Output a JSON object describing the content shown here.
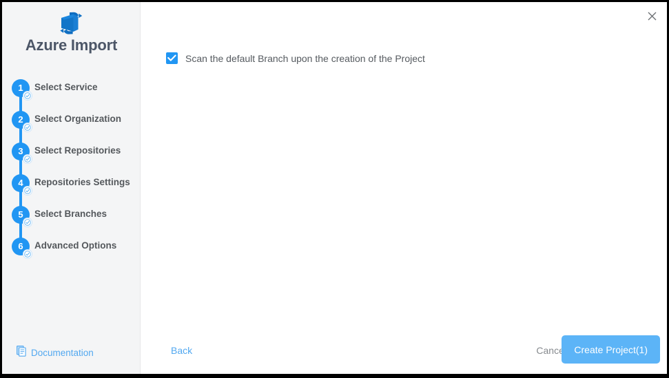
{
  "window": {
    "close_icon": "close-icon"
  },
  "sidebar": {
    "logo_icon": "azure-devops-logo-icon",
    "title": "Azure Import",
    "steps": [
      {
        "number": "1",
        "label": "Select Service",
        "completed": true
      },
      {
        "number": "2",
        "label": "Select Organization",
        "completed": true
      },
      {
        "number": "3",
        "label": "Select Repositories",
        "completed": true
      },
      {
        "number": "4",
        "label": "Repositories Settings",
        "completed": true
      },
      {
        "number": "5",
        "label": "Select Branches",
        "completed": true
      },
      {
        "number": "6",
        "label": "Advanced Options",
        "completed": true
      }
    ],
    "documentation": {
      "icon": "document-icon",
      "label": "Documentation"
    }
  },
  "main": {
    "options": [
      {
        "label": "Scan the default Branch upon the creation of the Project",
        "checked": true
      }
    ]
  },
  "footer": {
    "back_label": "Back",
    "cancel_label": "Cancel",
    "create_label": "Create Project(1)"
  },
  "colors": {
    "accent": "#2196f3",
    "button": "#5cb4f7",
    "link": "#52a8f0",
    "sidebar_bg": "#f4f5f6",
    "title_text": "#4c5667",
    "body_text": "#555a5f"
  }
}
